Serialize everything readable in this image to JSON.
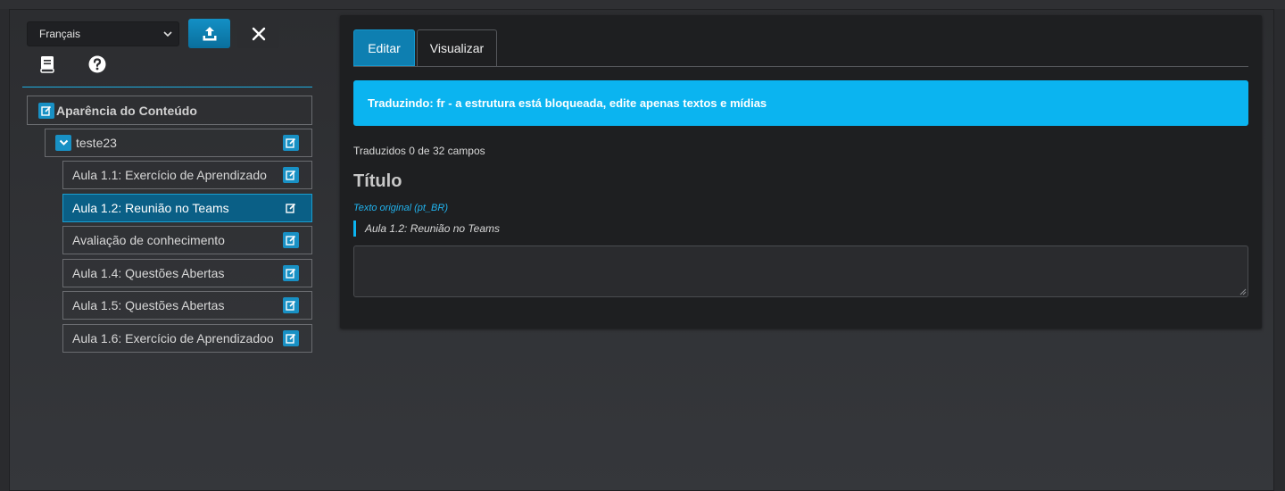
{
  "sidebar": {
    "language_selected": "Français",
    "tree": {
      "root": {
        "label": "Aparência do Conteúdo"
      },
      "section": {
        "label": "teste23"
      },
      "items": [
        {
          "label": "Aula 1.1: Exercício de Aprendizado",
          "active": false
        },
        {
          "label": "Aula 1.2: Reunião no Teams",
          "active": true
        },
        {
          "label": "Avaliação de conhecimento",
          "active": false
        },
        {
          "label": "Aula 1.4: Questões Abertas",
          "active": false
        },
        {
          "label": "Aula 1.5: Questões Abertas",
          "active": false
        },
        {
          "label": "Aula 1.6: Exercício de Aprendizadoo",
          "active": false
        }
      ]
    }
  },
  "main": {
    "tabs": [
      {
        "label": "Editar",
        "active": true
      },
      {
        "label": "Visualizar",
        "active": false
      }
    ],
    "alert": "Traduzindo: fr - a estrutura está bloqueada, edite apenas textos e mídias",
    "progress": "Traduzidos 0 de 32 campos",
    "field": {
      "title": "Título",
      "original_label": "Texto original (pt_BR)",
      "original_text": "Aula 1.2: Reunião no Teams",
      "value": ""
    }
  },
  "colors": {
    "accent": "#0bb4f0",
    "primary_button": "#1390c5",
    "active_item": "#0a5f86",
    "panel": "#1e1f21",
    "background": "#2c2d30"
  },
  "icons": {
    "upload": "upload-icon",
    "close": "close-icon",
    "book": "book-icon",
    "help": "help-icon",
    "edit": "edit-icon",
    "caret": "chevron-down-icon"
  }
}
